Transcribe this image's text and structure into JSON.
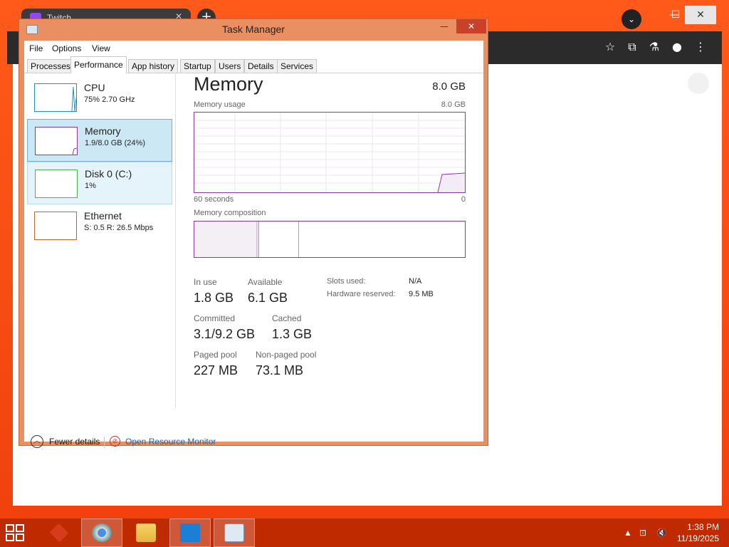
{
  "browser": {
    "tab_label": "Twitch",
    "newtab_symbol": "+",
    "toolbar_icons": [
      "star-icon",
      "extensions-icon",
      "labs-icon",
      "profile-icon",
      "menu-icon"
    ]
  },
  "task_manager": {
    "title": "Task Manager",
    "menu": [
      "File",
      "Options",
      "View"
    ],
    "tabs": [
      "Processes",
      "Performance",
      "App history",
      "Startup",
      "Users",
      "Details",
      "Services"
    ],
    "active_tab": "Performance",
    "sidebar": [
      {
        "name": "CPU",
        "sub": "75%  2.70 GHz",
        "color": "#1e90c8",
        "state": "normal"
      },
      {
        "name": "Memory",
        "sub": "1.9/8.0 GB (24%)",
        "color": "#8b3b9f",
        "state": "selected"
      },
      {
        "name": "Disk 0 (C:)",
        "sub": "1%",
        "color": "#4caf50",
        "state": "hover"
      },
      {
        "name": "Ethernet",
        "sub": "S: 0.5  R: 26.5 Mbps",
        "color": "#c2662d",
        "state": "normal"
      }
    ],
    "main": {
      "title": "Memory",
      "total": "8.0 GB",
      "usage_label": "Memory usage",
      "usage_max": "8.0 GB",
      "time_left": "60 seconds",
      "time_right": "0",
      "composition_label": "Memory composition",
      "stats": {
        "in_use_label": "In use",
        "in_use": "1.8 GB",
        "available_label": "Available",
        "available": "6.1 GB",
        "committed_label": "Committed",
        "committed": "3.1/9.2 GB",
        "cached_label": "Cached",
        "cached": "1.3 GB",
        "paged_label": "Paged pool",
        "paged": "227 MB",
        "nonpaged_label": "Non-paged pool",
        "nonpaged": "73.1 MB",
        "slots_label": "Slots used:",
        "slots": "N/A",
        "hwres_label": "Hardware reserved:",
        "hwres": "9.5 MB"
      }
    },
    "footer": {
      "fewer_details": "Fewer details",
      "open_resource_monitor": "Open Resource Monitor"
    }
  },
  "taskbar": {
    "time": "1:38 PM",
    "date": "11/19/2025",
    "items": [
      "app-icon",
      "chrome-icon",
      "file-explorer-icon",
      "settings-icon",
      "task-manager-icon"
    ]
  },
  "colors": {
    "accent_memory": "#8b3b9f",
    "selected_bg": "#cce8f4",
    "taskbar": "#c02a00",
    "window_frame": "#ea8f62"
  }
}
